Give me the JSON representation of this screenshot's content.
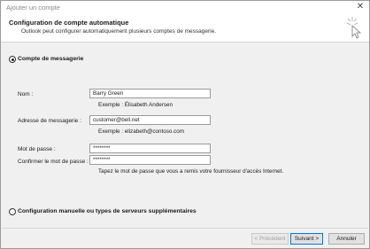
{
  "window": {
    "title": "Ajouter un compte",
    "close_glyph": "✕"
  },
  "header": {
    "title": "Configuration de compte automatique",
    "subtitle": "Outlook peut configurer automatiquement plusieurs comptes de messagerie.",
    "icon": "wizard-cursor-icon"
  },
  "option_email": {
    "label": "Compte de messagerie",
    "selected": true
  },
  "form": {
    "name_label": "Nom :",
    "name_value": "Barry Green",
    "name_hint": "Exemple : Élisabeth Andersen",
    "email_label": "Adresse de messagerie :",
    "email_value": "customer@bell.net",
    "email_hint": "Exemple : elizabeth@contoso.com",
    "password_label": "Mot de passe :",
    "password_value": "********",
    "confirm_label": "Confirmer le mot de passe :",
    "confirm_value": "********",
    "password_hint": "Tapez le mot de passe que vous a remis votre fournisseur d'accès Internet."
  },
  "option_manual": {
    "label": "Configuration manuelle ou types de serveurs supplémentaires",
    "selected": false
  },
  "buttons": {
    "prev": "< Précédent",
    "next": "Suivant >",
    "cancel": "Annuler"
  }
}
